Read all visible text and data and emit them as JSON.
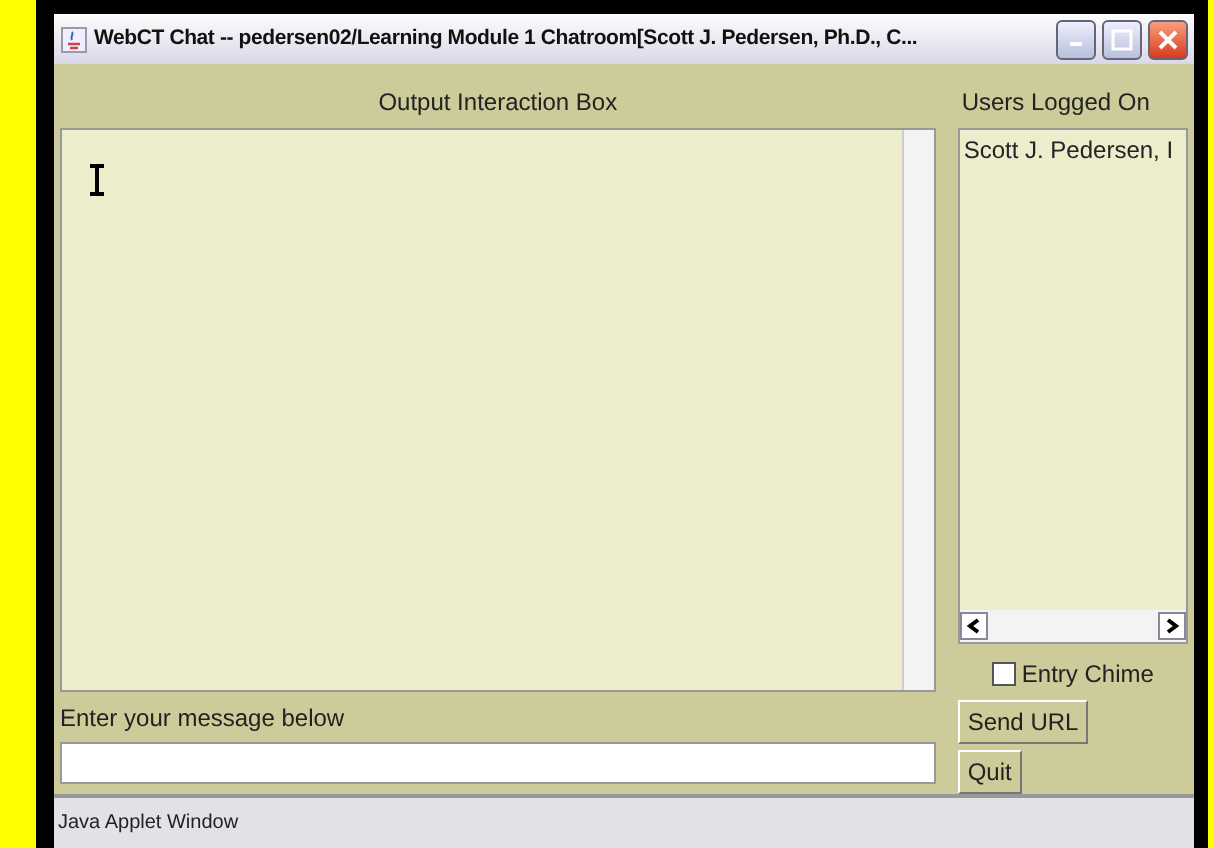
{
  "window": {
    "title": "WebCT Chat -- pedersen02/Learning Module 1 Chatroom[Scott J. Pedersen, Ph.D., C..."
  },
  "output": {
    "label": "Output Interaction Box"
  },
  "users": {
    "label": "Users Logged On",
    "items": [
      "Scott J. Pedersen, I"
    ]
  },
  "entry_chime": {
    "label": "Entry Chime",
    "checked": false
  },
  "message": {
    "label": "Enter your message below"
  },
  "buttons": [
    "Send URL",
    "Quit"
  ],
  "status_bar": "Java Applet Window"
}
